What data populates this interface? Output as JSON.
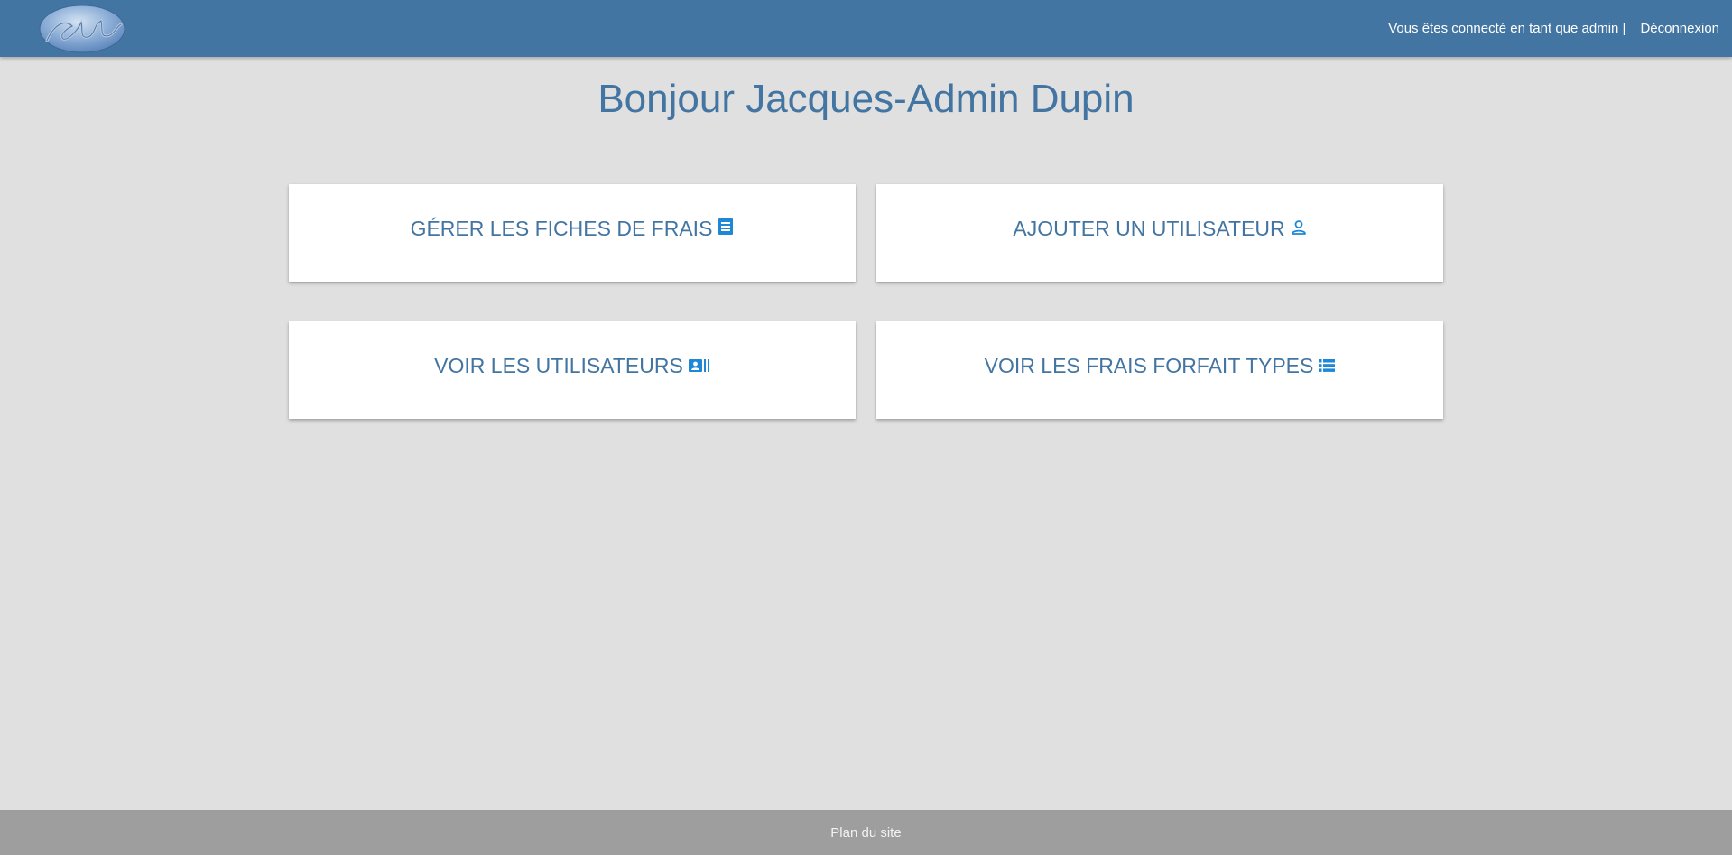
{
  "header": {
    "logo_icon": "gsb-logo",
    "connected_text": "Vous êtes connecté en tant que admin |",
    "logout_label": "Déconnexion"
  },
  "main": {
    "greeting": "Bonjour Jacques-Admin Dupin",
    "cards": [
      {
        "label": "GÉRER LES FICHES DE FRAIS",
        "icon": "receipt-icon"
      },
      {
        "label": "AJOUTER UN UTILISATEUR",
        "icon": "person-icon"
      },
      {
        "label": "VOIR LES UTILISATEURS",
        "icon": "contact-card-icon"
      },
      {
        "label": "VOIR LES FRAIS FORFAIT TYPES",
        "icon": "list-icon"
      }
    ]
  },
  "footer": {
    "sitemap_label": "Plan du site"
  },
  "colors": {
    "primary": "#4375a2",
    "icon_accent": "#1e88d6",
    "background": "#e0e0e0",
    "footer": "#9e9e9e"
  }
}
